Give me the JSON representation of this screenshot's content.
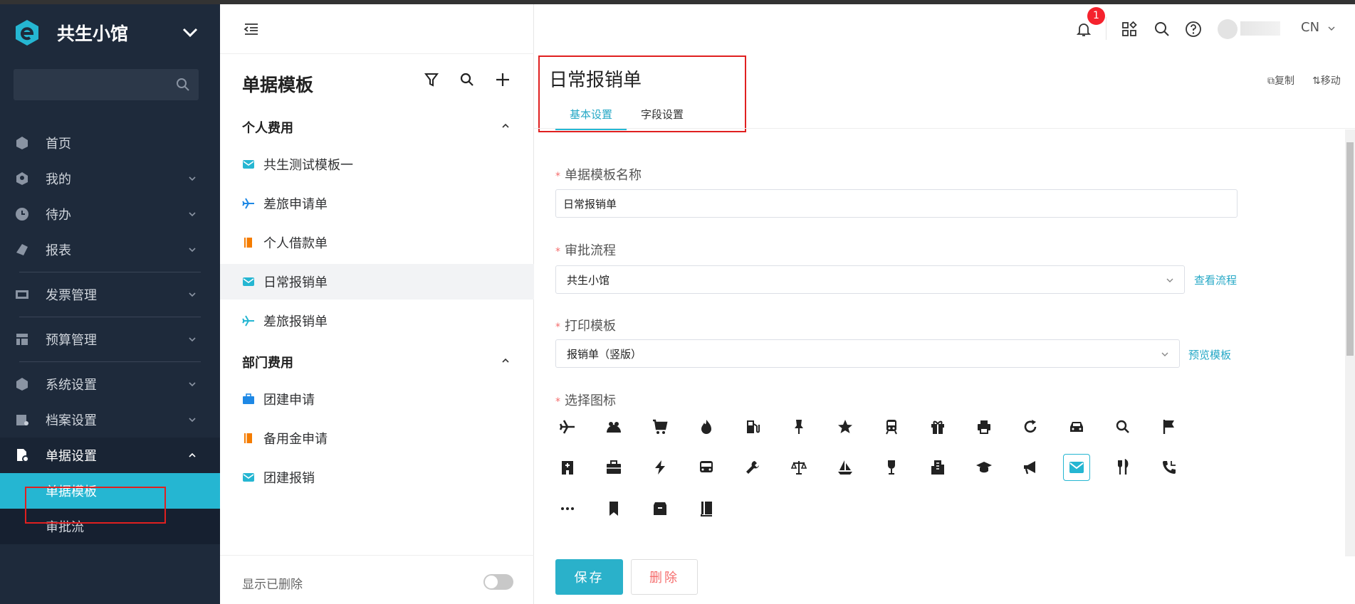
{
  "brand": {
    "name": "共生小馆"
  },
  "sidebar": {
    "items": [
      {
        "label": "首页",
        "icon": "home-icon"
      },
      {
        "label": "我的",
        "icon": "user-icon"
      },
      {
        "label": "待办",
        "icon": "clock-icon"
      },
      {
        "label": "报表",
        "icon": "report-icon"
      },
      {
        "label": "发票管理",
        "icon": "invoice-icon"
      },
      {
        "label": "预算管理",
        "icon": "budget-icon"
      },
      {
        "label": "系统设置",
        "icon": "settings-icon"
      },
      {
        "label": "档案设置",
        "icon": "archive-icon"
      },
      {
        "label": "单据设置",
        "icon": "document-settings-icon"
      }
    ],
    "subitems": [
      {
        "label": "单据模板"
      },
      {
        "label": "审批流"
      }
    ]
  },
  "list": {
    "title": "单据模板",
    "groups": [
      {
        "name": "个人费用",
        "items": [
          {
            "label": "共生测试模板一",
            "icon": "mail-icon",
            "color": "#25b6d2"
          },
          {
            "label": "差旅申请单",
            "icon": "plane-icon",
            "color": "#1e88e5"
          },
          {
            "label": "个人借款单",
            "icon": "book-icon",
            "color": "#f57c00"
          },
          {
            "label": "日常报销单",
            "icon": "mail-icon",
            "color": "#25b6d2"
          },
          {
            "label": "差旅报销单",
            "icon": "plane-icon",
            "color": "#25b6d2"
          }
        ]
      },
      {
        "name": "部门费用",
        "items": [
          {
            "label": "团建申请",
            "icon": "briefcase-icon",
            "color": "#1e88e5"
          },
          {
            "label": "备用金申请",
            "icon": "book-icon",
            "color": "#f57c00"
          },
          {
            "label": "团建报销",
            "icon": "mail-icon",
            "color": "#25b6d2"
          }
        ]
      }
    ],
    "show_deleted": "显示已删除"
  },
  "header": {
    "notification_count": "1",
    "lang": "CN"
  },
  "main": {
    "title": "日常报销单",
    "tabs": [
      "基本设置",
      "字段设置"
    ],
    "copy": "复制",
    "move": "移动",
    "name_label": "单据模板名称",
    "name_value": "日常报销单",
    "flow_label": "审批流程",
    "flow_value": "共生小馆",
    "flow_link": "查看流程",
    "print_label": "打印模板",
    "print_value": "报销单（竖版）",
    "print_link": "预览模板",
    "icon_label": "选择图标",
    "save": "保存",
    "delete": "删除"
  },
  "accent": "#25b6d2"
}
